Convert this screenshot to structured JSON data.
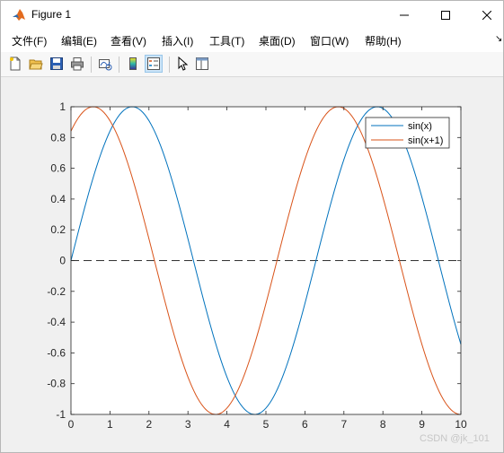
{
  "window": {
    "title": "Figure 1"
  },
  "menu": {
    "items": [
      "文件(F)",
      "编辑(E)",
      "查看(V)",
      "插入(I)",
      "工具(T)",
      "桌面(D)",
      "窗口(W)",
      "帮助(H)"
    ]
  },
  "toolbar": {
    "icons": [
      "new-figure-icon",
      "open-file-icon",
      "save-icon",
      "print-icon",
      "link-plot-icon",
      "insert-colorbar-icon",
      "insert-legend-icon",
      "edit-pointer-icon",
      "property-inspector-icon"
    ]
  },
  "watermark": "CSDN @jk_101",
  "chart_data": {
    "type": "line",
    "xlim": [
      0,
      10
    ],
    "ylim": [
      -1,
      1
    ],
    "xticks": [
      "0",
      "1",
      "2",
      "3",
      "4",
      "5",
      "6",
      "7",
      "8",
      "9",
      "10"
    ],
    "yticks": [
      "-1",
      "-0.8",
      "-0.6",
      "-0.4",
      "-0.2",
      "0",
      "0.2",
      "0.4",
      "0.6",
      "0.8",
      "1"
    ],
    "x_start": 0,
    "x_end": 10,
    "x_step": 0.05,
    "series": [
      {
        "name": "sin(x)",
        "function": "sin(x)",
        "color": "#0072bd"
      },
      {
        "name": "sin(x+1)",
        "function": "sin(x+1)",
        "color": "#d95319"
      }
    ],
    "reference_line": {
      "y": 0,
      "style": "dashed",
      "color": "#333333"
    },
    "legend": {
      "position": "top-right"
    },
    "grid": false
  }
}
